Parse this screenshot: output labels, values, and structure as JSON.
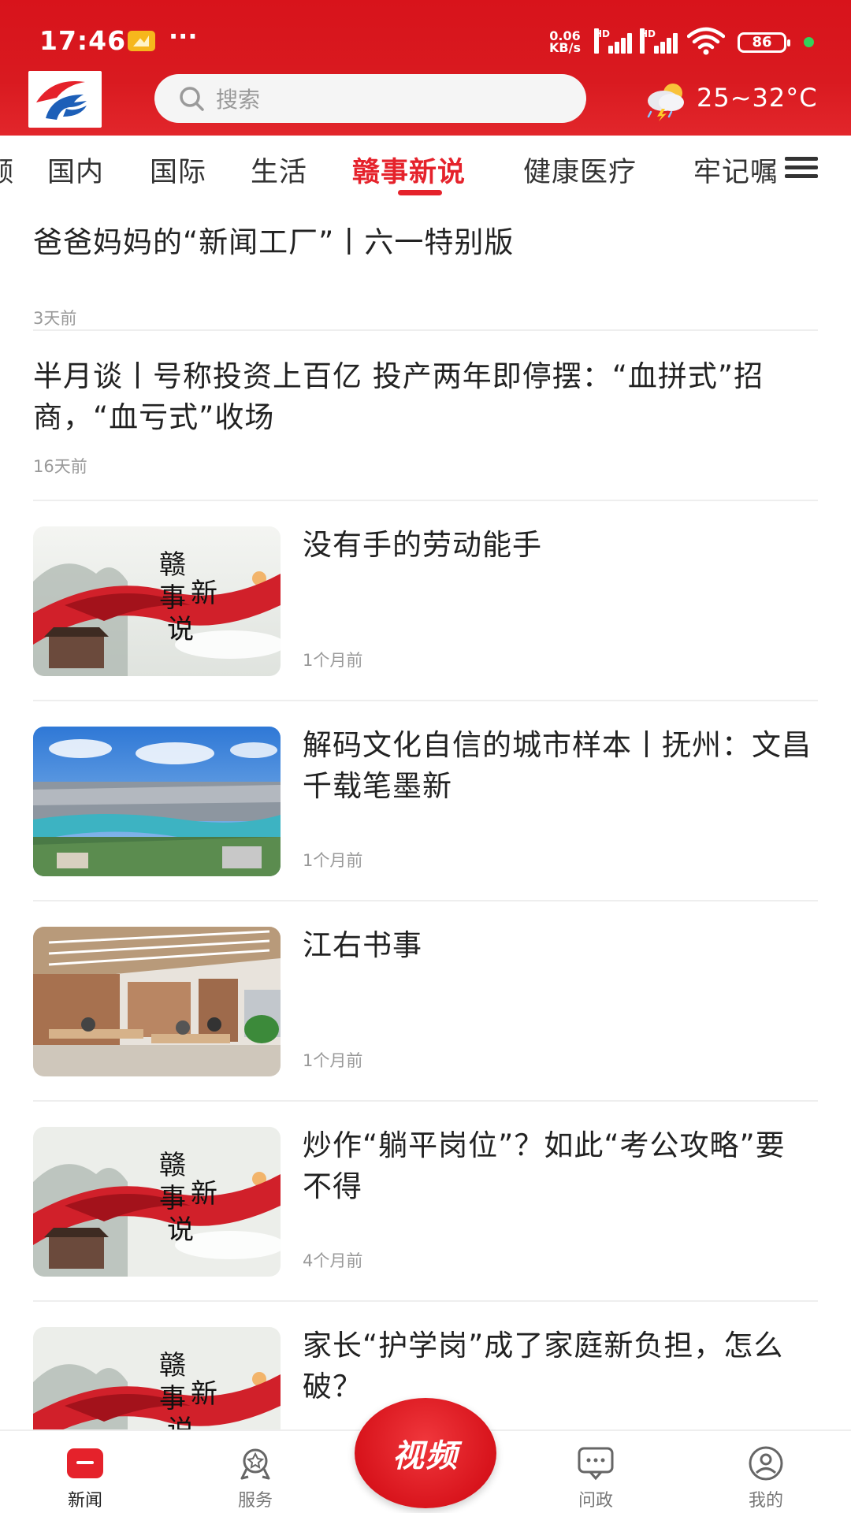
{
  "status_bar": {
    "time": "17:46",
    "net_speed_value": "0.06",
    "net_speed_unit": "KB/s",
    "sim1_label": "HD",
    "sim2_label": "HD",
    "battery": "86",
    "more": "···"
  },
  "header": {
    "search_placeholder": "搜索",
    "temperature": "25~32°C",
    "weather_icon": "thunderstorm-cloud-icon",
    "brand_color": "#d8131b"
  },
  "tabs": [
    {
      "label": "频"
    },
    {
      "label": "国内"
    },
    {
      "label": "国际"
    },
    {
      "label": "生活"
    },
    {
      "label": "赣事新说",
      "active": true
    },
    {
      "label": "健康医疗"
    },
    {
      "label": "牢记嘱托"
    }
  ],
  "feed": {
    "items": [
      {
        "title": "爸爸妈妈的“新闻工厂”丨六一特别版",
        "meta": "3天前"
      },
      {
        "title": "半月谈丨号称投资上百亿 投产两年即停摆：“血拼式”招商，“血亏式”收场",
        "meta": "16天前"
      },
      {
        "title": "没有手的劳动能手",
        "meta": "1个月前",
        "thumb": "ganshi-xinshuo-banner"
      },
      {
        "title": "解码文化自信的城市样本丨抚州：文昌千载笔墨新",
        "meta": "1个月前",
        "thumb": "city-aerial-photo"
      },
      {
        "title": "江右书事",
        "meta": "1个月前",
        "thumb": "library-interior-photo"
      },
      {
        "title": "炒作“躺平岗位”？如此“考公攻略”要不得",
        "meta": "4个月前",
        "thumb": "ganshi-xinshuo-banner"
      },
      {
        "title": "家长“护学岗”成了家庭新负担，怎么破？",
        "meta": "",
        "thumb": "ganshi-xinshuo-banner"
      }
    ],
    "banner_text": [
      "赣",
      "事",
      "新",
      "说"
    ]
  },
  "bottom_nav": {
    "news": "新闻",
    "service": "服务",
    "video": "视频",
    "politics": "问政",
    "mine": "我的"
  }
}
